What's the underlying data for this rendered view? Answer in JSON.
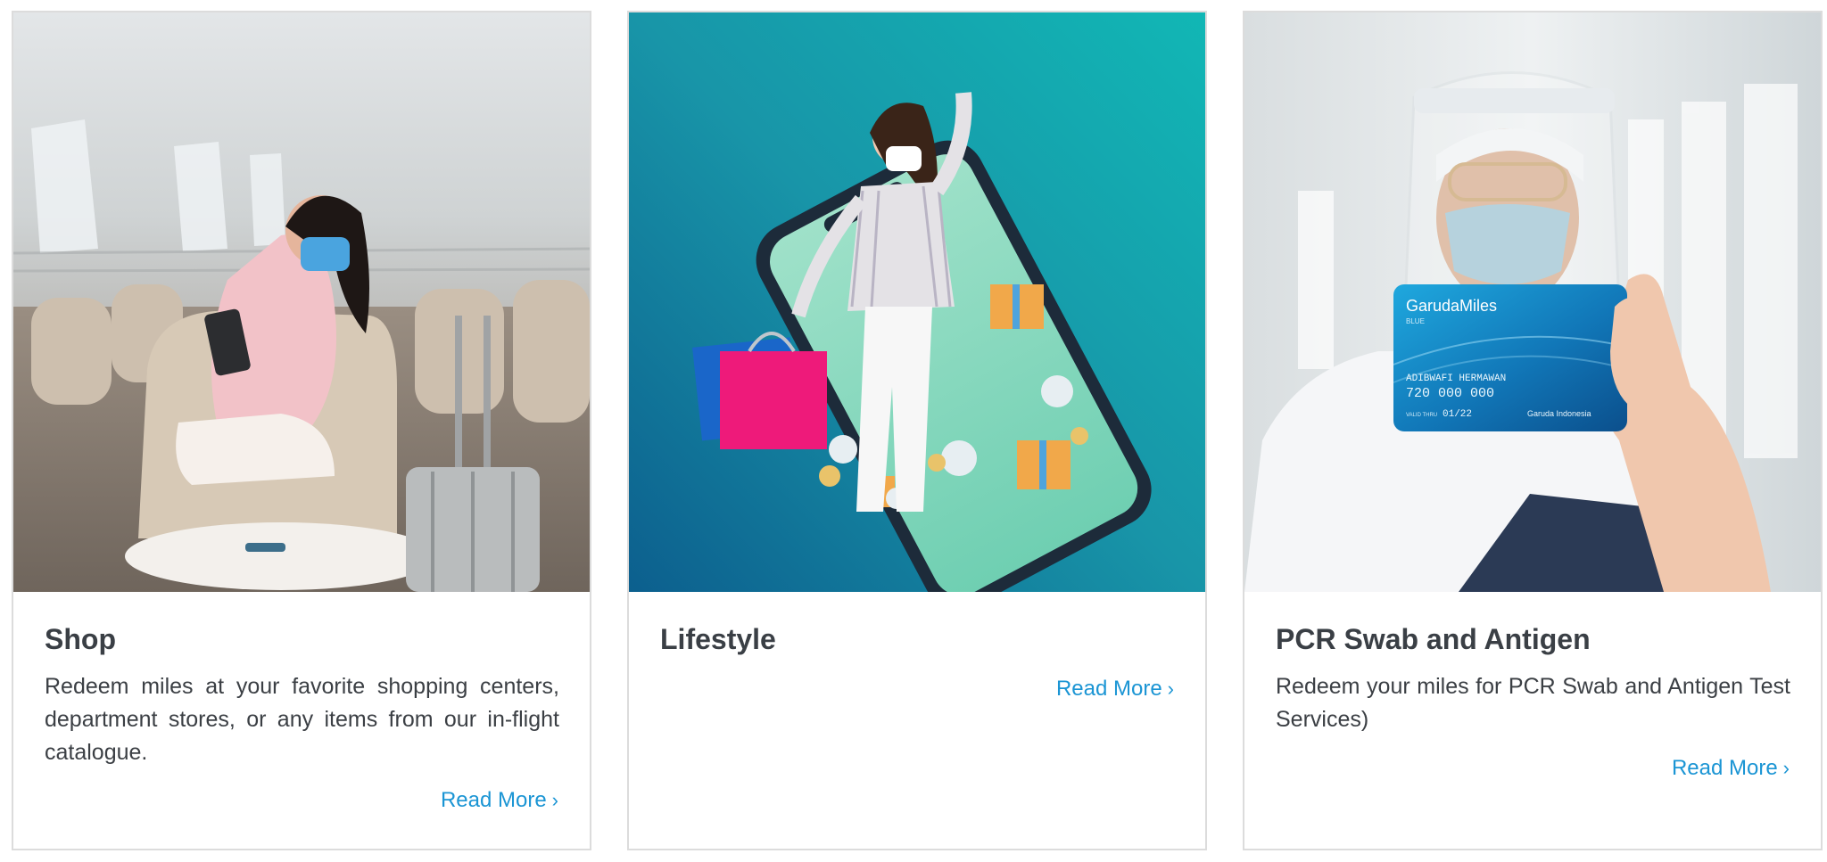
{
  "cards": [
    {
      "title": "Shop",
      "description": "Redeem miles at your favorite shopping centers, department stores, or any items from our in-flight catalogue.",
      "link_label": "Read More",
      "image": "woman-in-airport-lounge-with-tablet"
    },
    {
      "title": "Lifestyle",
      "description": "",
      "link_label": "Read More",
      "image": "woman-stepping-out-of-smartphone-with-shopping-bags"
    },
    {
      "title": "PCR Swab and Antigen",
      "description": "Redeem your miles for PCR Swab and Antigen Test Services)",
      "link_label": "Read More",
      "image": "health-worker-holding-garudamiles-card",
      "card_graphic": {
        "brand": "GarudaMiles",
        "tier": "BLUE",
        "holder": "ADIBWAFI HERMAWAN",
        "number": "720 000 000",
        "valid_label": "VALID THRU",
        "valid": "01/22",
        "issuer": "Garuda Indonesia"
      }
    }
  ],
  "icons": {
    "link_chevron": "chevron-right-icon"
  },
  "colors": {
    "link": "#1b95d4",
    "title": "#3a3f45",
    "text": "#3b3f44",
    "border": "#dcdcdc"
  }
}
